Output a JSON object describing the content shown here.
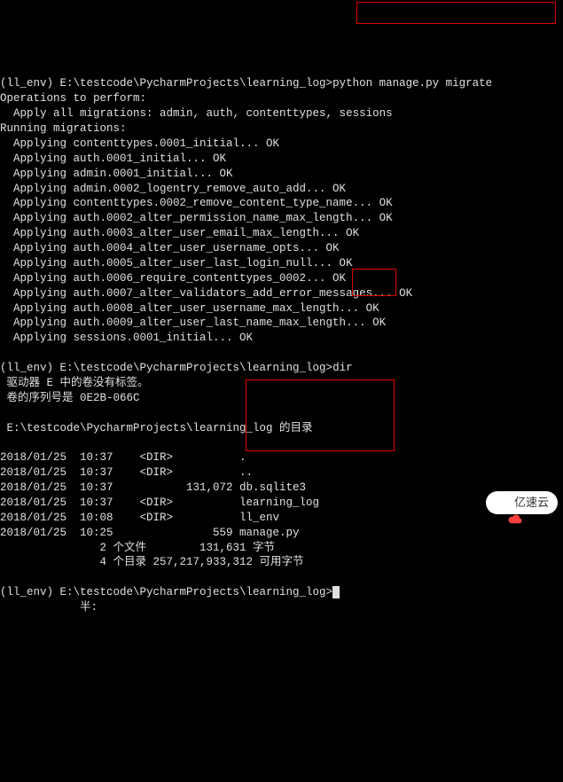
{
  "prompt1_prefix": "(ll_env) E:\\testcode\\PycharmProjects\\learning_log>",
  "prompt1_cmd": "python manage.py migrate",
  "output_header": "Operations to perform:",
  "apply_all": "  Apply all migrations: admin, auth, contenttypes, sessions",
  "running": "Running migrations:",
  "migrations": [
    "  Applying contenttypes.0001_initial... OK",
    "  Applying auth.0001_initial... OK",
    "  Applying admin.0001_initial... OK",
    "  Applying admin.0002_logentry_remove_auto_add... OK",
    "  Applying contenttypes.0002_remove_content_type_name... OK",
    "  Applying auth.0002_alter_permission_name_max_length... OK",
    "  Applying auth.0003_alter_user_email_max_length... OK",
    "  Applying auth.0004_alter_user_username_opts... OK",
    "  Applying auth.0005_alter_user_last_login_null... OK",
    "  Applying auth.0006_require_contenttypes_0002... OK",
    "  Applying auth.0007_alter_validators_add_error_messages... OK",
    "  Applying auth.0008_alter_user_username_max_length... OK",
    "  Applying auth.0009_alter_user_last_name_max_length... OK",
    "  Applying sessions.0001_initial... OK"
  ],
  "blank": "",
  "prompt2_prefix": "(ll_env) E:\\testcode\\PycharmProjects\\learning_log>",
  "prompt2_cmd": "dir",
  "dir_drive": " 驱动器 E 中的卷没有标签。",
  "dir_serial": " 卷的序列号是 0E2B-066C",
  "dir_header": " E:\\testcode\\PycharmProjects\\learning_log 的目录",
  "dir_lines": [
    "2018/01/25  10:37    <DIR>          .",
    "2018/01/25  10:37    <DIR>          ..",
    "2018/01/25  10:37           131,072 db.sqlite3",
    "2018/01/25  10:37    <DIR>          learning_log",
    "2018/01/25  10:08    <DIR>          ll_env",
    "2018/01/25  10:25               559 manage.py",
    "               2 个文件        131,631 字节",
    "               4 个目录 257,217,933,312 可用字节"
  ],
  "prompt3_prefix": "(ll_env) E:\\testcode\\PycharmProjects\\learning_log>",
  "prompt3_trail": "            半:",
  "watermark_text": "亿速云"
}
